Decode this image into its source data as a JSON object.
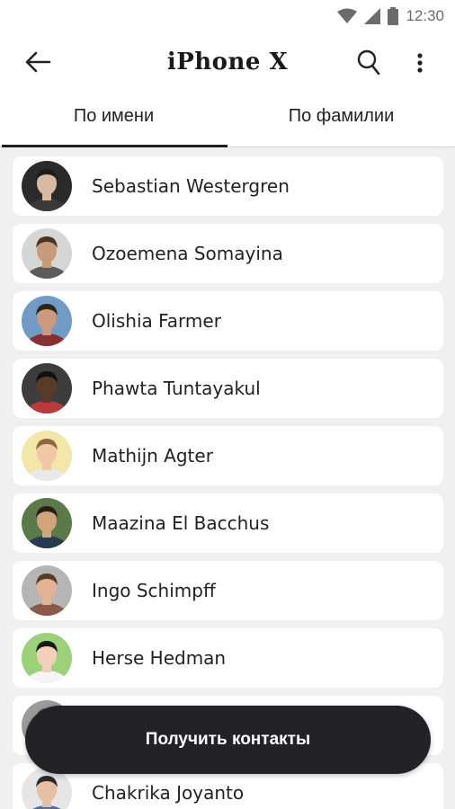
{
  "status_bar": {
    "time": "12:30",
    "icons": [
      "wifi-icon",
      "cell-signal-icon",
      "battery-icon"
    ]
  },
  "app_bar": {
    "title": "iPhone X",
    "back_icon": "arrow-left-icon",
    "search_icon": "search-icon",
    "more_icon": "more-vertical-icon"
  },
  "tabs": [
    {
      "label": "По имени",
      "active": true
    },
    {
      "label": "По фамилии",
      "active": false
    }
  ],
  "contacts": [
    {
      "name": "Sebastian Westergren",
      "avatar_bg": "#2b2b2b",
      "skin": "#d9b9a0",
      "hair": "#1c1c1c",
      "shirt": "#3a3a3a"
    },
    {
      "name": "Ozoemena Somayina",
      "avatar_bg": "#d6d6d6",
      "skin": "#c79a7c",
      "hair": "#4a3326",
      "shirt": "#5c5c5c"
    },
    {
      "name": "Olishia Farmer",
      "avatar_bg": "#6f9bc4",
      "skin": "#c99a7d",
      "hair": "#2f2219",
      "shirt": "#8a2f2f"
    },
    {
      "name": "Phawta Tuntayakul",
      "avatar_bg": "#3d3d3d",
      "skin": "#5a3a28",
      "hair": "#111111",
      "shirt": "#b83a3a"
    },
    {
      "name": "Mathijn Agter",
      "avatar_bg": "#f2e6a8",
      "skin": "#f0c8a6",
      "hair": "#8a6a3a",
      "shirt": "#e8e8e8"
    },
    {
      "name": "Maazina El Bacchus",
      "avatar_bg": "#5b7a4a",
      "skin": "#d2a47c",
      "hair": "#2a1d14",
      "shirt": "#263a52"
    },
    {
      "name": "Ingo Schimpff",
      "avatar_bg": "#b5b5b5",
      "skin": "#e2b294",
      "hair": "#5a3a22",
      "shirt": "#8c5a4a"
    },
    {
      "name": "Herse Hedman",
      "avatar_bg": "#9cd17a",
      "skin": "#f2d1b8",
      "hair": "#1a1a1a",
      "shirt": "#f5f5f5"
    },
    {
      "name": "",
      "avatar_bg": "#9a9a9a",
      "skin": "#d6b096",
      "hair": "#4a4a4a",
      "shirt": "#6a6a6a"
    },
    {
      "name": "Chakrika Joyanto",
      "avatar_bg": "#e6e6e6",
      "skin": "#e6bfa3",
      "hair": "#2a2a2a",
      "shirt": "#4a6fa5"
    }
  ],
  "action_button": {
    "label": "Получить контакты"
  }
}
